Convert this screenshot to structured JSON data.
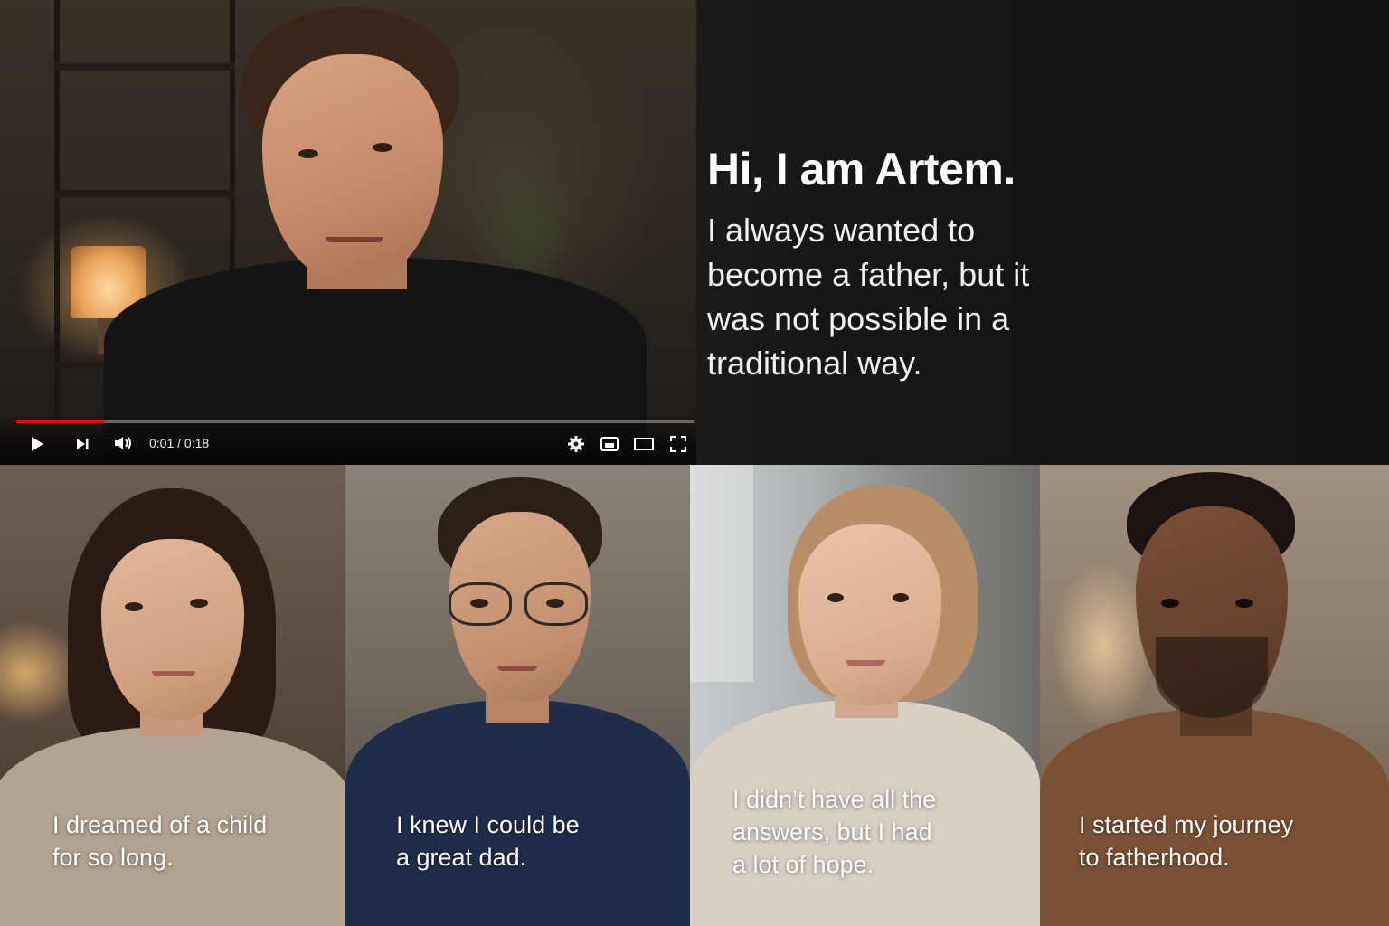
{
  "player": {
    "time_current": "0:01",
    "time_separator": " / ",
    "time_total": "0:18",
    "progress_fraction": 0.13,
    "icons": {
      "play": "play-icon",
      "next": "next-icon",
      "volume": "volume-icon",
      "settings": "gear-icon",
      "miniplayer": "miniplayer-icon",
      "theater": "theater-icon",
      "fullscreen": "fullscreen-icon"
    },
    "accent": "#ff0000"
  },
  "hero": {
    "title": "Hi, I am Artem.",
    "lines": [
      "I always wanted to",
      "become a father, but it",
      "was not possible in a",
      "traditional way."
    ]
  },
  "cards": [
    {
      "lines": [
        "I dreamed of a child",
        "for so long."
      ]
    },
    {
      "lines": [
        "I knew I could be",
        "a great dad."
      ]
    },
    {
      "lines": [
        "I didn’t have all the",
        "answers, but I had",
        "a lot of hope."
      ]
    },
    {
      "lines": [
        "I started my journey",
        "to fatherhood."
      ]
    }
  ]
}
